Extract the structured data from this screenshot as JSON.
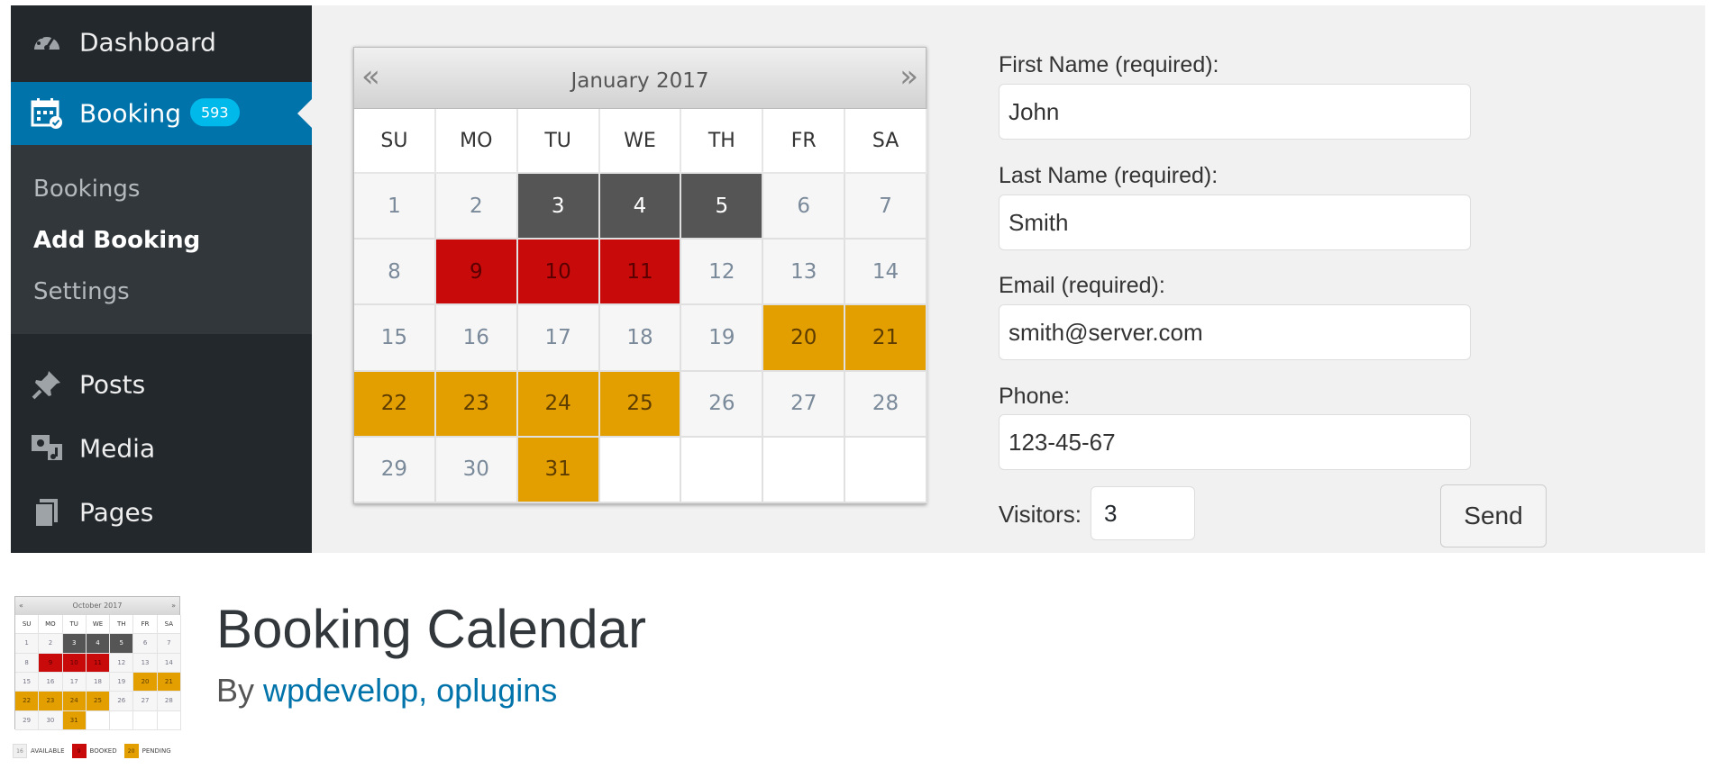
{
  "sidebar": {
    "dashboard": {
      "label": "Dashboard",
      "icon": "dashboard-icon"
    },
    "booking": {
      "label": "Booking",
      "badge": "593",
      "icon": "calendar-icon"
    },
    "submenu": {
      "bookings": "Bookings",
      "add_booking": "Add Booking",
      "settings": "Settings"
    },
    "posts": {
      "label": "Posts",
      "icon": "pushpin-icon"
    },
    "media": {
      "label": "Media",
      "icon": "media-icon"
    },
    "pages": {
      "label": "Pages",
      "icon": "pages-icon"
    }
  },
  "calendar": {
    "title": "January 2017",
    "prev": "«",
    "next": "»",
    "weekdays": [
      "SU",
      "MO",
      "TU",
      "WE",
      "TH",
      "FR",
      "SA"
    ],
    "days": [
      {
        "d": "1",
        "s": "available"
      },
      {
        "d": "2",
        "s": "available"
      },
      {
        "d": "3",
        "s": "unavailable"
      },
      {
        "d": "4",
        "s": "unavailable"
      },
      {
        "d": "5",
        "s": "unavailable"
      },
      {
        "d": "6",
        "s": "available"
      },
      {
        "d": "7",
        "s": "available"
      },
      {
        "d": "8",
        "s": "available"
      },
      {
        "d": "9",
        "s": "booked"
      },
      {
        "d": "10",
        "s": "booked"
      },
      {
        "d": "11",
        "s": "booked"
      },
      {
        "d": "12",
        "s": "available"
      },
      {
        "d": "13",
        "s": "available"
      },
      {
        "d": "14",
        "s": "available"
      },
      {
        "d": "15",
        "s": "available"
      },
      {
        "d": "16",
        "s": "available"
      },
      {
        "d": "17",
        "s": "available"
      },
      {
        "d": "18",
        "s": "available"
      },
      {
        "d": "19",
        "s": "available"
      },
      {
        "d": "20",
        "s": "pending"
      },
      {
        "d": "21",
        "s": "pending"
      },
      {
        "d": "22",
        "s": "pending"
      },
      {
        "d": "23",
        "s": "pending"
      },
      {
        "d": "24",
        "s": "pending"
      },
      {
        "d": "25",
        "s": "pending"
      },
      {
        "d": "26",
        "s": "available"
      },
      {
        "d": "27",
        "s": "available"
      },
      {
        "d": "28",
        "s": "available"
      },
      {
        "d": "29",
        "s": "available"
      },
      {
        "d": "30",
        "s": "available"
      },
      {
        "d": "31",
        "s": "pending"
      },
      {
        "d": "",
        "s": "empty"
      },
      {
        "d": "",
        "s": "empty"
      },
      {
        "d": "",
        "s": "empty"
      },
      {
        "d": "",
        "s": "empty"
      }
    ]
  },
  "form": {
    "first_name_label": "First Name (required):",
    "first_name_value": "John",
    "last_name_label": "Last Name (required):",
    "last_name_value": "Smith",
    "email_label": "Email (required):",
    "email_value": "smith@server.com",
    "phone_label": "Phone:",
    "phone_value": "123-45-67",
    "visitors_label": "Visitors:",
    "visitors_value": "3",
    "send_label": "Send"
  },
  "plugin": {
    "title": "Booking Calendar",
    "by": "By",
    "authors": "wpdevelop, oplugins"
  },
  "thumbnail": {
    "title": "October 2017",
    "prev": "«",
    "next": "»",
    "legend": [
      {
        "swatch": "16",
        "label": "AVAILABLE"
      },
      {
        "swatch": "9",
        "label": "BOOKED"
      },
      {
        "swatch": "20",
        "label": "PENDING"
      }
    ]
  },
  "colors": {
    "sidebar_bg": "#23282d",
    "active_bg": "#0073aa",
    "badge_bg": "#00b9eb",
    "unavailable": "#555555",
    "booked": "#c80a0a",
    "pending": "#e39e00",
    "link": "#0073aa"
  }
}
